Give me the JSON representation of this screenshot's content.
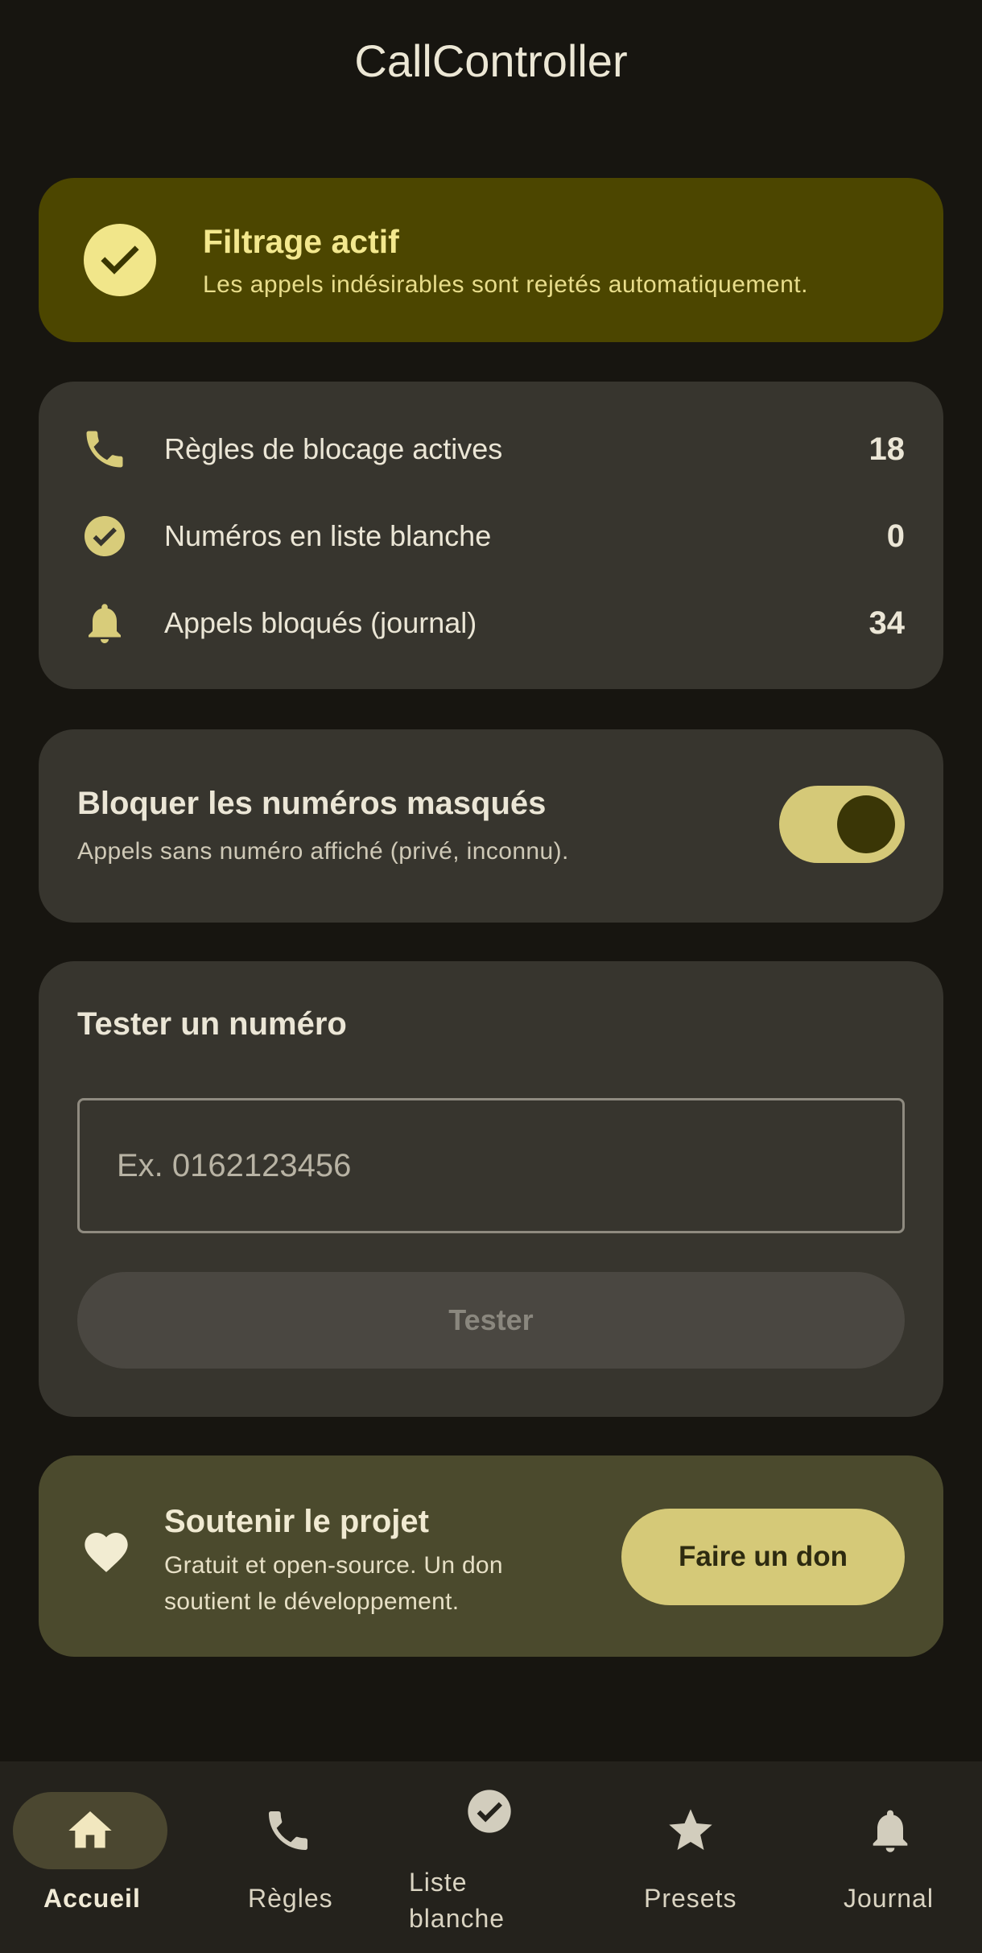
{
  "app": {
    "title": "CallController"
  },
  "status": {
    "title": "Filtrage actif",
    "subtitle": "Les appels indésirables sont rejetés automatiquement.",
    "icon": "check-circle-icon"
  },
  "stats": [
    {
      "icon": "phone-icon",
      "label": "Règles de blocage actives",
      "value": "18"
    },
    {
      "icon": "check-circle-icon",
      "label": "Numéros en liste blanche",
      "value": "0"
    },
    {
      "icon": "bell-icon",
      "label": "Appels bloqués (journal)",
      "value": "34"
    }
  ],
  "hidden_numbers": {
    "title": "Bloquer les numéros masqués",
    "subtitle": "Appels sans numéro affiché (privé, inconnu).",
    "enabled": true
  },
  "test_number": {
    "title": "Tester un numéro",
    "value": "",
    "placeholder": "Ex. 0162123456",
    "button_label": "Tester",
    "button_enabled": false
  },
  "support": {
    "title": "Soutenir le projet",
    "subtitle": "Gratuit et open-source. Un don soutient le développement.",
    "button_label": "Faire un don",
    "icon": "heart-icon"
  },
  "nav": {
    "items": [
      {
        "label": "Accueil",
        "icon": "home-icon",
        "active": true
      },
      {
        "label": "Règles",
        "icon": "phone-icon",
        "active": false
      },
      {
        "label": "Liste blanche",
        "icon": "check-circle-icon",
        "active": false
      },
      {
        "label": "Presets",
        "icon": "star-icon",
        "active": false
      },
      {
        "label": "Journal",
        "icon": "bell-icon",
        "active": false
      }
    ]
  },
  "colors": {
    "background": "#171510",
    "status_card": "#4c4600",
    "card": "#37352e",
    "accent": "#d5c978",
    "support_card": "#4b4a2d"
  }
}
